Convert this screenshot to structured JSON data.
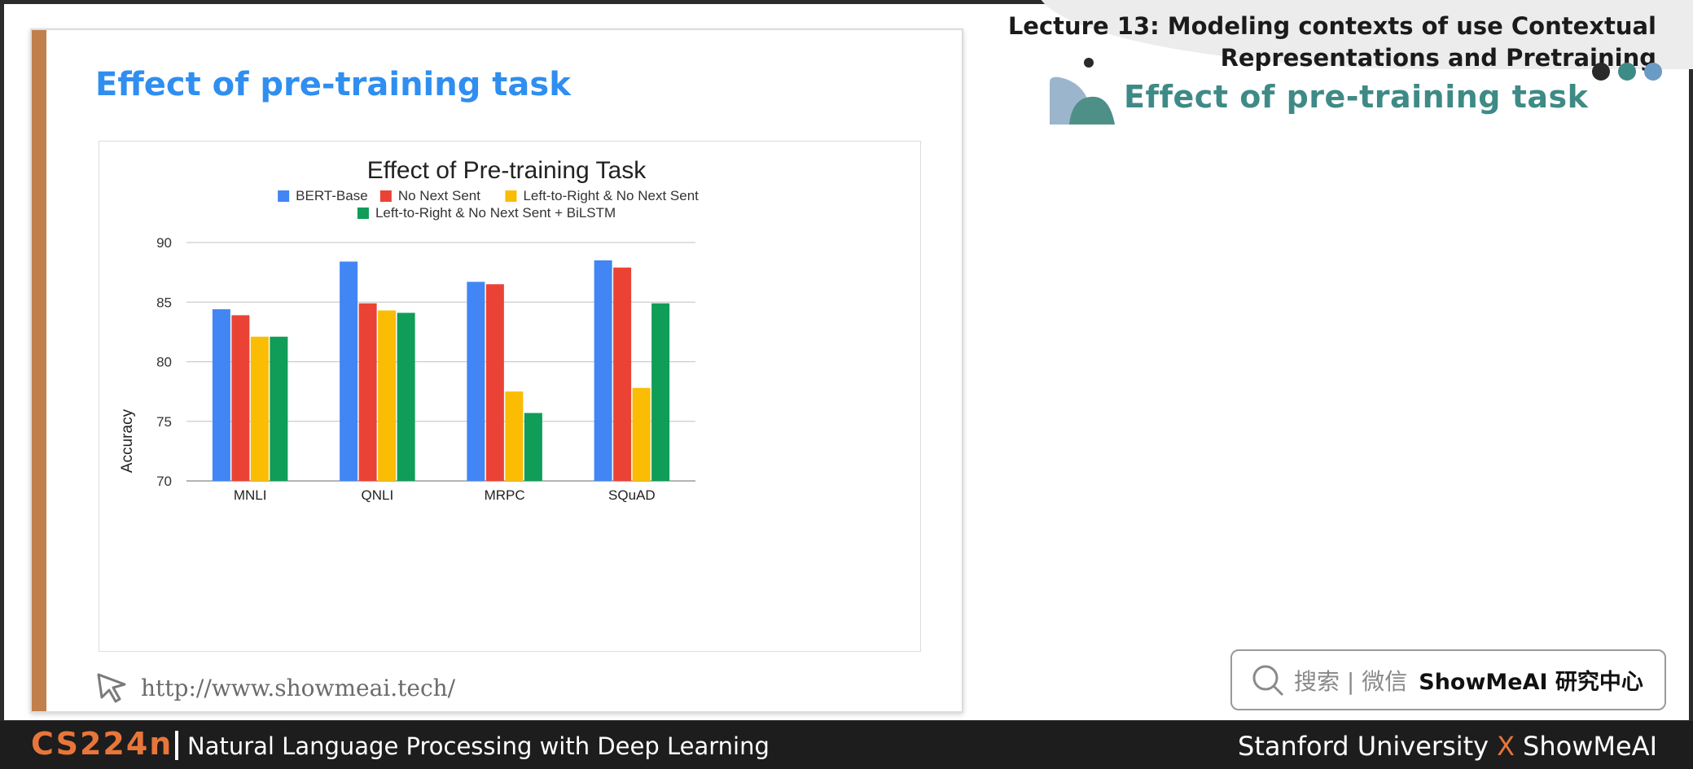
{
  "header": {
    "lecture_title_line1": "Lecture 13:  Modeling contexts of use Contextual",
    "lecture_title_line2": "Representations and Pretraining",
    "section_title": "Effect of pre-training task"
  },
  "slide": {
    "heading": "Effect of pre-training task",
    "url": "http://www.showmeai.tech/"
  },
  "search_badge": {
    "text": "搜索 | 微信",
    "brand": "ShowMeAI 研究中心"
  },
  "footer": {
    "course_code": "CS224n",
    "course_name": "Natural Language Processing with Deep Learning",
    "credit_left": "Stanford University",
    "credit_x": "X",
    "credit_right": "ShowMeAI"
  },
  "colors": {
    "accent_blue": "#2f8ef0",
    "teal": "#3e8a86",
    "orange": "#e8763a",
    "slide_bar": "#c17f4b"
  },
  "chart_data": {
    "type": "bar",
    "title": "Effect of Pre-training Task",
    "xlabel": "",
    "ylabel": "Accuracy",
    "ylim": [
      70,
      90
    ],
    "yticks": [
      70,
      75,
      80,
      85,
      90
    ],
    "grid": true,
    "legend_position": "top",
    "categories": [
      "MNLI",
      "QNLI",
      "MRPC",
      "SQuAD"
    ],
    "series": [
      {
        "name": "BERT-Base",
        "color": "#4285f4",
        "values": [
          84.4,
          88.4,
          86.7,
          88.5
        ]
      },
      {
        "name": "No Next Sent",
        "color": "#ea4335",
        "values": [
          83.9,
          84.9,
          86.5,
          87.9
        ]
      },
      {
        "name": "Left-to-Right & No Next Sent",
        "color": "#fbbc04",
        "values": [
          82.1,
          84.3,
          77.5,
          77.8
        ]
      },
      {
        "name": "Left-to-Right & No Next Sent + BiLSTM",
        "color": "#0f9d58",
        "values": [
          82.1,
          84.1,
          75.7,
          84.9
        ]
      }
    ]
  }
}
